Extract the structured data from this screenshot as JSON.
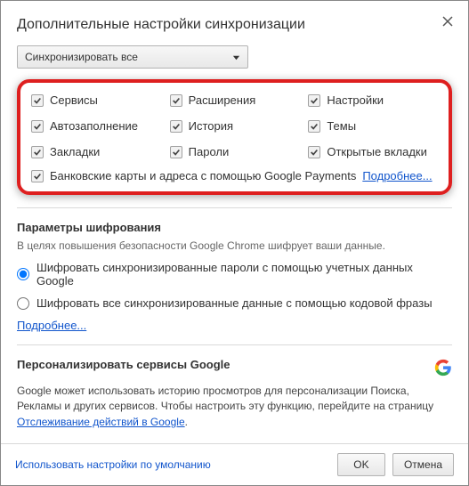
{
  "title": "Дополнительные настройки синхронизации",
  "dropdown": {
    "selected": "Синхронизировать все"
  },
  "sync": {
    "items": [
      "Сервисы",
      "Расширения",
      "Настройки",
      "Автозаполнение",
      "История",
      "Темы",
      "Закладки",
      "Пароли",
      "Открытые вкладки"
    ],
    "lastLabel": "Банковские карты и адреса с помощью Google Payments",
    "lastLink": "Подробнее..."
  },
  "encryption": {
    "title": "Параметры шифрования",
    "desc": "В целях повышения безопасности Google Chrome шифрует ваши данные.",
    "opt1": "Шифровать синхронизированные пароли с помощью учетных данных Google",
    "opt2": "Шифровать все синхронизированные данные с помощью кодовой фразы",
    "more": "Подробнее..."
  },
  "personalize": {
    "title": "Персонализировать сервисы Google",
    "body": "Google может использовать историю просмотров для персонализации Поиска, Рекламы и других сервисов. Чтобы настроить эту функцию, перейдите на страницу ",
    "link": "Отслеживание действий в Google"
  },
  "footer": {
    "defaults": "Использовать настройки по умолчанию",
    "ok": "OK",
    "cancel": "Отмена"
  }
}
